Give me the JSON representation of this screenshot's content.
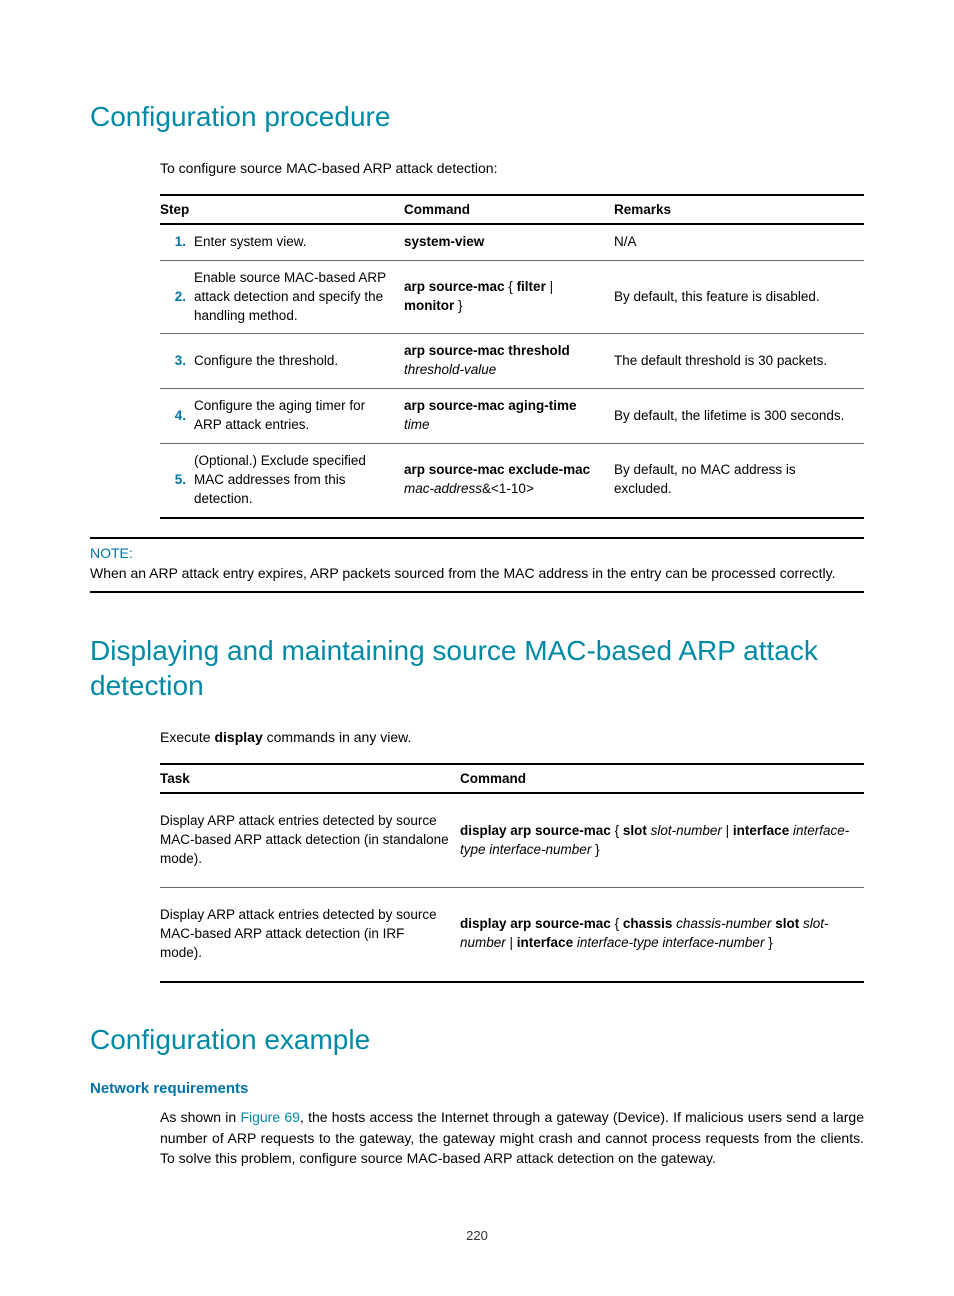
{
  "h1": "Configuration procedure",
  "intro1": "To configure source MAC-based ARP attack detection:",
  "table1": {
    "headers": {
      "step": "Step",
      "command": "Command",
      "remarks": "Remarks"
    },
    "rows": [
      {
        "num": "1.",
        "step": "Enter system view.",
        "cmd_b1": "system-view",
        "remarks": "N/A"
      },
      {
        "num": "2.",
        "step": "Enable source MAC-based ARP attack detection and specify the handling method.",
        "cmd_b1": "arp source-mac",
        "cmd_plain1": " { ",
        "cmd_b2": "filter",
        "cmd_plain2": " | ",
        "cmd_b3": "monitor",
        "cmd_plain3": " }",
        "remarks": "By default, this feature is disabled."
      },
      {
        "num": "3.",
        "step": "Configure the threshold.",
        "cmd_b1": "arp source-mac threshold",
        "cmd_i1": "threshold-value",
        "remarks": "The default threshold is 30 packets."
      },
      {
        "num": "4.",
        "step": "Configure the aging timer for ARP attack entries.",
        "cmd_b1": "arp source-mac aging-time",
        "cmd_i1": "time",
        "remarks": "By default, the lifetime is 300 seconds."
      },
      {
        "num": "5.",
        "step": "(Optional.) Exclude specified MAC addresses from this detection.",
        "cmd_b1": "arp source-mac exclude-mac",
        "cmd_i1": "mac-address",
        "cmd_plain_after_i": "&<1-10>",
        "remarks": "By default, no MAC address is excluded."
      }
    ]
  },
  "note": {
    "label": "NOTE:",
    "text": "When an ARP attack entry expires, ARP packets sourced from the MAC address in the entry can be processed correctly."
  },
  "h2": "Displaying and maintaining source MAC-based ARP attack detection",
  "intro2_pre": "Execute ",
  "intro2_bold": "display",
  "intro2_post": " commands in any view.",
  "table2": {
    "headers": {
      "task": "Task",
      "command": "Command"
    },
    "rows": [
      {
        "task": "Display ARP attack entries detected by source MAC-based ARP attack detection (in standalone mode).",
        "c_b1": "display arp source-mac",
        "c_p1": " { ",
        "c_b2": "slot",
        "c_i1": "slot-number",
        "c_p2": " | ",
        "c_b3": "interface",
        "c_i2": "interface-type interface-number",
        "c_p3": " }"
      },
      {
        "task": "Display ARP attack entries detected by source MAC-based ARP attack detection (in IRF mode).",
        "c_b1": "display arp source-mac",
        "c_p1": " { ",
        "c_b2": "chassis",
        "c_i1": "chassis-number",
        "c_b2b": "slot",
        "c_i1b": "slot-number",
        "c_p2": " | ",
        "c_b3": "interface",
        "c_i2": "interface-type interface-number",
        "c_p3": " }"
      }
    ]
  },
  "h3": "Configuration example",
  "sub_head": "Network requirements",
  "example_pre": "As shown in ",
  "example_link": "Figure 69",
  "example_post": ", the hosts access the Internet through a gateway (Device). If malicious users send a large number of ARP requests to the gateway, the gateway might crash and cannot process requests from the clients. To solve this problem, configure source MAC-based ARP attack detection on the gateway.",
  "page_number": "220"
}
